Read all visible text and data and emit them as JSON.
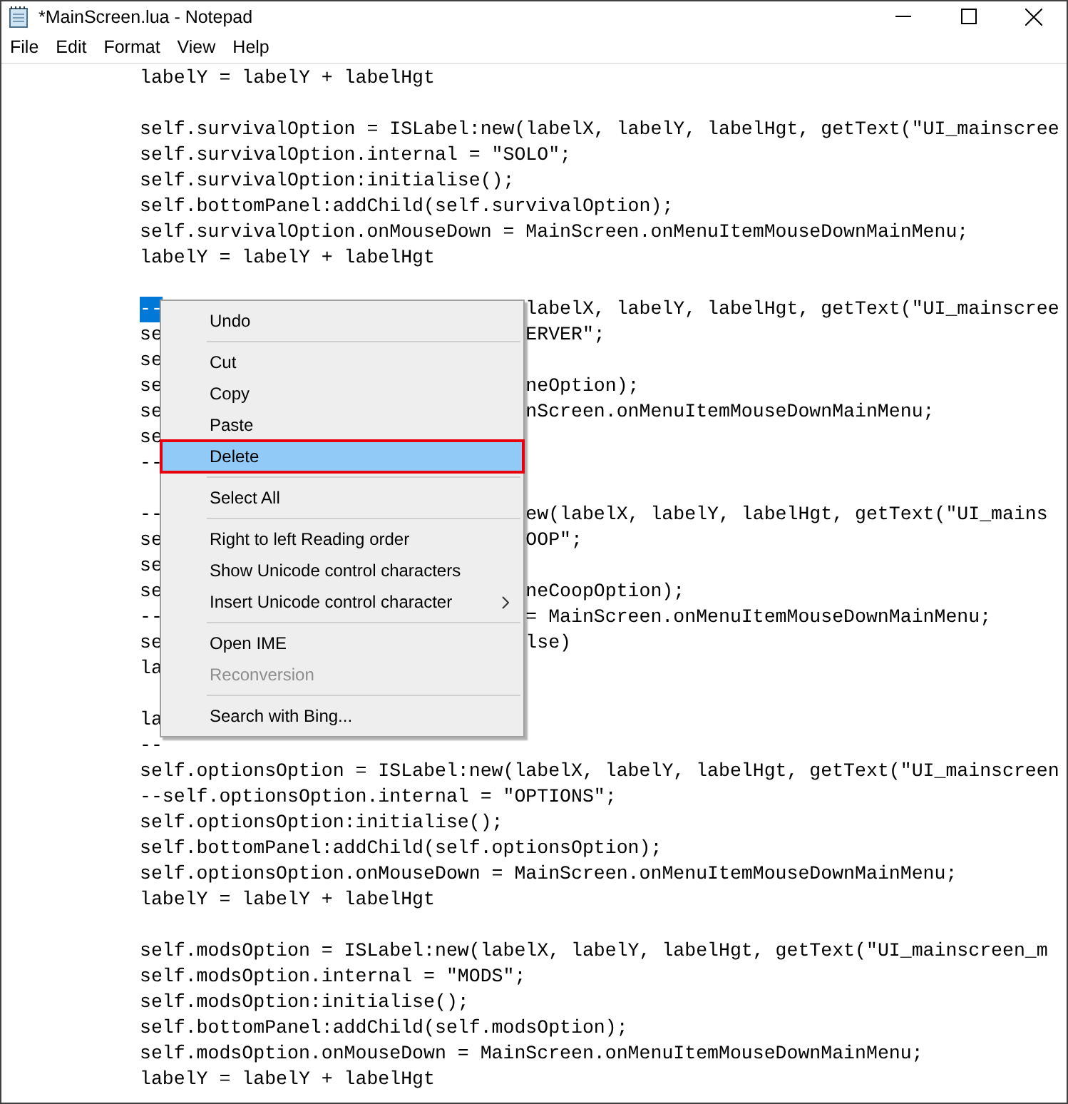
{
  "window": {
    "title": "*MainScreen.lua - Notepad"
  },
  "menu_bar": [
    "File",
    "Edit",
    "Format",
    "View",
    "Help"
  ],
  "lines": [
    {
      "kind": "line",
      "text": "labelY = labelY + labelHgt"
    },
    {
      "kind": "blank"
    },
    {
      "kind": "line",
      "text": "self.survivalOption = ISLabel:new(labelX, labelY, labelHgt, getText(\"UI_mainscree"
    },
    {
      "kind": "line",
      "text": "self.survivalOption.internal = \"SOLO\";"
    },
    {
      "kind": "line",
      "text": "self.survivalOption:initialise();"
    },
    {
      "kind": "line",
      "text": "self.bottomPanel:addChild(self.survivalOption);"
    },
    {
      "kind": "line",
      "text": "self.survivalOption.onMouseDown = MainScreen.onMenuItemMouseDownMainMenu;"
    },
    {
      "kind": "line",
      "text": "labelY = labelY + labelHgt"
    },
    {
      "kind": "blank"
    },
    {
      "kind": "covered",
      "left": "--",
      "selected": true,
      "right": "labelX, labelY, labelHgt, getText(\"UI_mainscree"
    },
    {
      "kind": "covered",
      "left": "se",
      "selected": false,
      "right": "ERVER\";"
    },
    {
      "kind": "covered",
      "left": "se",
      "selected": false
    },
    {
      "kind": "covered",
      "left": "se",
      "selected": false,
      "right": "neOption);"
    },
    {
      "kind": "covered",
      "left": "se",
      "selected": false,
      "right": "nScreen.onMenuItemMouseDownMainMenu;"
    },
    {
      "kind": "covered",
      "left": "se",
      "selected": false
    },
    {
      "kind": "covered",
      "left": "--",
      "selected": false
    },
    {
      "kind": "blank"
    },
    {
      "kind": "covered",
      "left": "--",
      "selected": false,
      "right": "ew(labelX, labelY, labelHgt, getText(\"UI_mains"
    },
    {
      "kind": "covered",
      "left": "se",
      "selected": false,
      "right": "OOP\";"
    },
    {
      "kind": "covered",
      "left": "se",
      "selected": false
    },
    {
      "kind": "covered",
      "left": "se",
      "selected": false,
      "right": "neCoopOption);"
    },
    {
      "kind": "covered",
      "left": "--",
      "selected": false,
      "right": "= MainScreen.onMenuItemMouseDownMainMenu;"
    },
    {
      "kind": "covered",
      "left": "se",
      "selected": false,
      "right": "lse)"
    },
    {
      "kind": "covered",
      "left": "la",
      "selected": false
    },
    {
      "kind": "blank"
    },
    {
      "kind": "covered",
      "left": "la",
      "selected": false
    },
    {
      "kind": "line",
      "text": "--"
    },
    {
      "kind": "line",
      "text": "self.optionsOption = ISLabel:new(labelX, labelY, labelHgt, getText(\"UI_mainscreen"
    },
    {
      "kind": "line",
      "text": "--self.optionsOption.internal = \"OPTIONS\";"
    },
    {
      "kind": "line",
      "text": "self.optionsOption:initialise();"
    },
    {
      "kind": "line",
      "text": "self.bottomPanel:addChild(self.optionsOption);"
    },
    {
      "kind": "line",
      "text": "self.optionsOption.onMouseDown = MainScreen.onMenuItemMouseDownMainMenu;"
    },
    {
      "kind": "line",
      "text": "labelY = labelY + labelHgt"
    },
    {
      "kind": "blank"
    },
    {
      "kind": "line",
      "text": "self.modsOption = ISLabel:new(labelX, labelY, labelHgt, getText(\"UI_mainscreen_m"
    },
    {
      "kind": "line",
      "text": "self.modsOption.internal = \"MODS\";"
    },
    {
      "kind": "line",
      "text": "self.modsOption:initialise();"
    },
    {
      "kind": "line",
      "text": "self.bottomPanel:addChild(self.modsOption);"
    },
    {
      "kind": "line",
      "text": "self.modsOption.onMouseDown = MainScreen.onMenuItemMouseDownMainMenu;"
    },
    {
      "kind": "line",
      "text": "labelY = labelY + labelHgt"
    }
  ],
  "context_menu": [
    {
      "kind": "item",
      "label": "Undo",
      "selected": false,
      "disabled": false
    },
    {
      "kind": "separator"
    },
    {
      "kind": "item",
      "label": "Cut",
      "selected": false,
      "disabled": false
    },
    {
      "kind": "item",
      "label": "Copy",
      "selected": false,
      "disabled": false
    },
    {
      "kind": "item",
      "label": "Paste",
      "selected": false,
      "disabled": false
    },
    {
      "kind": "item",
      "label": "Delete",
      "selected": true,
      "disabled": false,
      "annotated": true
    },
    {
      "kind": "separator"
    },
    {
      "kind": "item",
      "label": "Select All",
      "selected": false,
      "disabled": false
    },
    {
      "kind": "separator"
    },
    {
      "kind": "item",
      "label": "Right to left Reading order",
      "selected": false,
      "disabled": false
    },
    {
      "kind": "item",
      "label": "Show Unicode control characters",
      "selected": false,
      "disabled": false
    },
    {
      "kind": "item",
      "label": "Insert Unicode control character",
      "selected": false,
      "disabled": false,
      "submenu": true
    },
    {
      "kind": "separator"
    },
    {
      "kind": "item",
      "label": "Open IME",
      "selected": false,
      "disabled": false
    },
    {
      "kind": "item",
      "label": "Reconversion",
      "selected": false,
      "disabled": true
    },
    {
      "kind": "separator"
    },
    {
      "kind": "item",
      "label": "Search with Bing...",
      "selected": false,
      "disabled": false
    }
  ]
}
